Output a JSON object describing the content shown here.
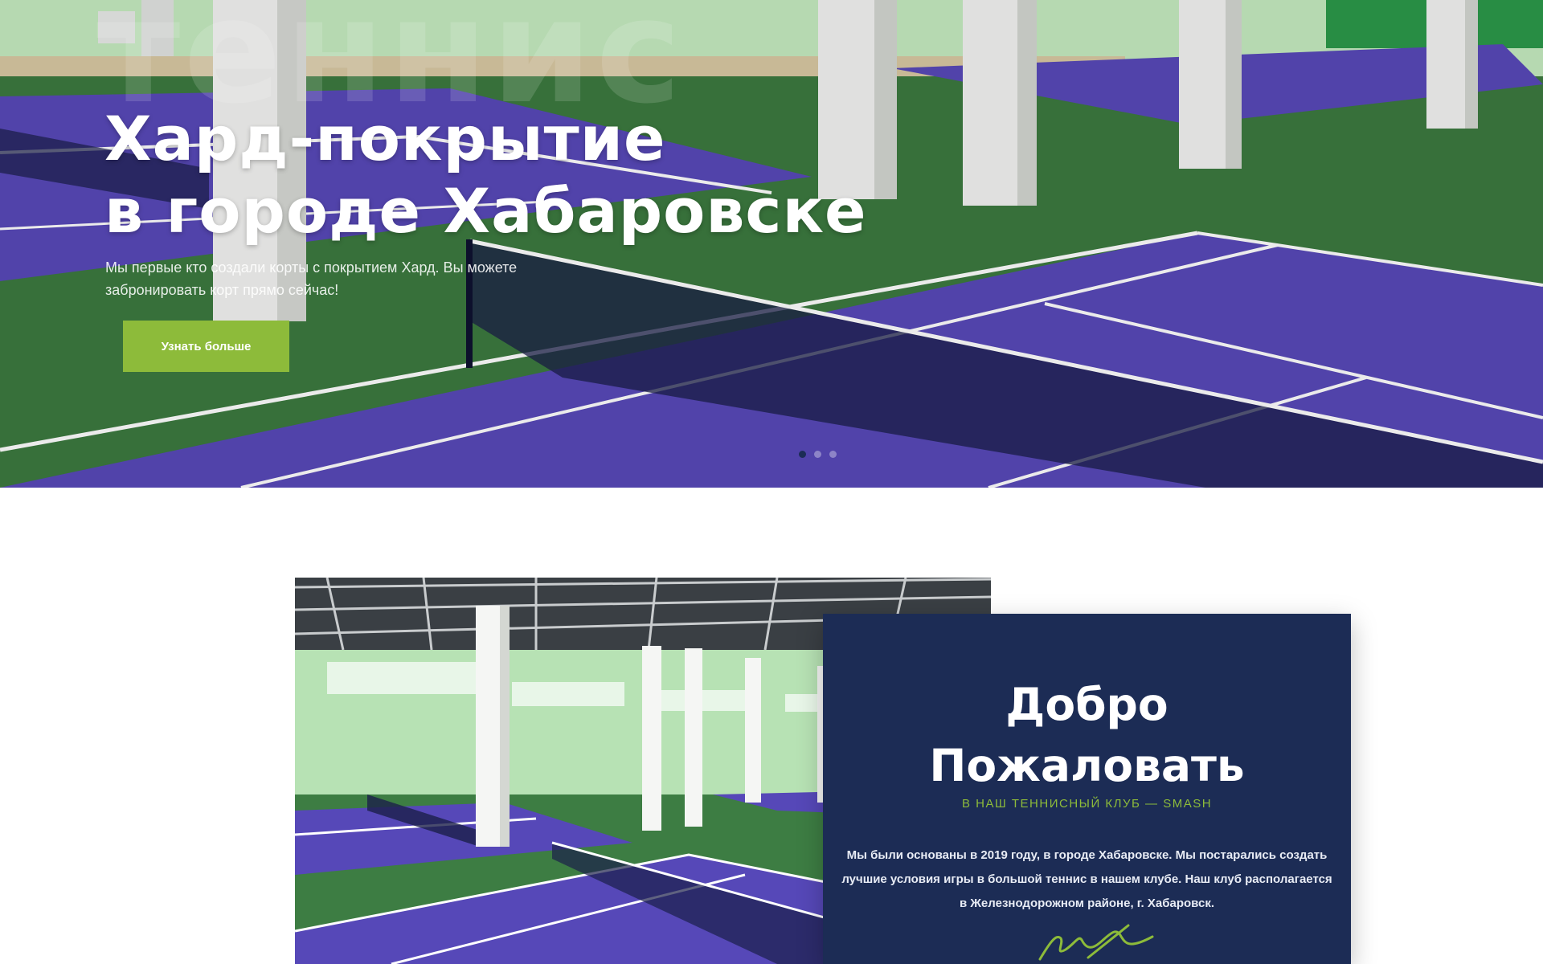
{
  "hero": {
    "background_word": "теннис",
    "title_line1": "Хард-покрытие",
    "title_line2": "в городе Хабаровске",
    "subtitle": "Мы первые кто создали корты с покрытием Хард. Вы можете забронировать корт прямо сейчас!",
    "button_label": "Узнать больше",
    "slides": 3,
    "active_slide": 1
  },
  "about": {
    "title_line1": "Добро",
    "title_line2": "Пожаловать",
    "subtitle": "В НАШ ТЕННИСНЫЙ КЛУБ — SMASH",
    "text": "Мы были основаны в 2019 году, в городе Хабаровске. Мы постарались создать лучшие условия игры в большой теннис в нашем клубе. Наш клуб располагается в Железнодорожном районе, г. Хабаровск."
  },
  "colors": {
    "accent": "#8dbb3a",
    "navy": "#1c2c55",
    "court": "#5849b9",
    "turf": "#3c7a3f"
  }
}
